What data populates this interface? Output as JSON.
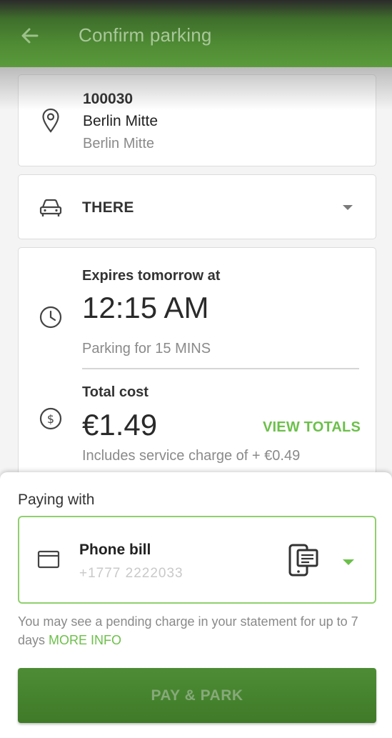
{
  "header": {
    "title": "Confirm parking",
    "back_icon": "arrow-left-icon"
  },
  "location": {
    "code": "100030",
    "city": "Berlin Mitte",
    "area": "Berlin Mitte",
    "icon": "map-pin-icon"
  },
  "vehicle": {
    "plate": "THERE",
    "icon": "car-icon"
  },
  "session": {
    "expires_label": "Expires tomorrow at",
    "expires_time": "12:15 AM",
    "duration_text": "Parking for 15 MINS",
    "cost_label": "Total cost",
    "cost_value": "€1.49",
    "view_totals": "VIEW TOTALS",
    "service_charge": "Includes service charge of + €0.49"
  },
  "payment": {
    "label": "Paying with",
    "method": "Phone bill",
    "number": "+1777 2222033",
    "note": "You may see a pending charge in your statement for up to 7 days",
    "more_info": "MORE INFO"
  },
  "actions": {
    "pay_label": "PAY & PARK"
  },
  "colors": {
    "accent": "#6cc04a",
    "header": "#4e8a33"
  }
}
